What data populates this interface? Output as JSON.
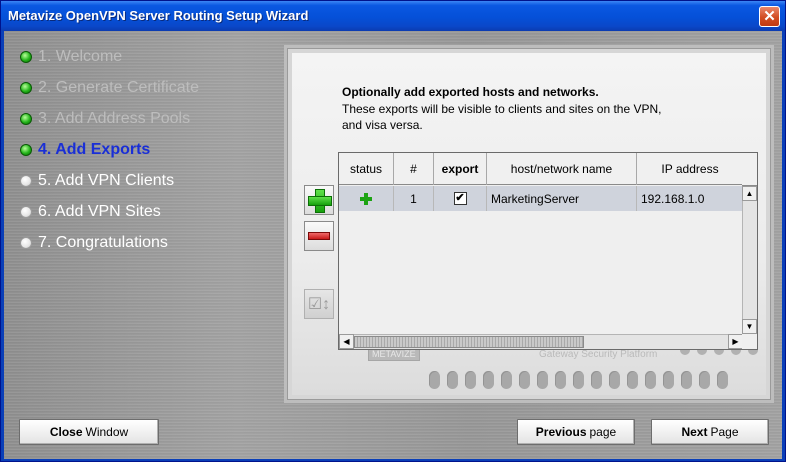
{
  "window": {
    "title": "Metavize OpenVPN Server Routing Setup Wizard"
  },
  "steps": [
    {
      "label": "1. Welcome",
      "state": "done"
    },
    {
      "label": "2. Generate Certificate",
      "state": "done"
    },
    {
      "label": "3. Add Address Pools",
      "state": "done"
    },
    {
      "label": "4. Add Exports",
      "state": "current"
    },
    {
      "label": "5. Add VPN Clients",
      "state": "todo"
    },
    {
      "label": "6. Add VPN Sites",
      "state": "todo"
    },
    {
      "label": "7. Congratulations",
      "state": "todo"
    }
  ],
  "content": {
    "heading": "Optionally add exported hosts and networks.",
    "desc_line1": "These exports will be visible to clients and sites on the VPN,",
    "desc_line2": "and visa versa."
  },
  "table": {
    "columns": [
      "status",
      "#",
      "export",
      "host/network name",
      "IP address"
    ],
    "rows": [
      {
        "status_icon": "plus-icon",
        "num": "1",
        "export": true,
        "name": "MarketingServer",
        "ip": "192.168.1.0"
      }
    ]
  },
  "appliance": {
    "logo": "METAVIZE",
    "tagline": "Gateway Security Platform"
  },
  "buttons": {
    "close_bold": "Close",
    "close_rest": "Window",
    "prev_bold": "Previous",
    "prev_rest": "page",
    "next_bold": "Next",
    "next_rest": "Page"
  },
  "colors": {
    "titlebar": "#0550d8",
    "current_step": "#1a2fd6",
    "done_dot": "#23b41a"
  }
}
